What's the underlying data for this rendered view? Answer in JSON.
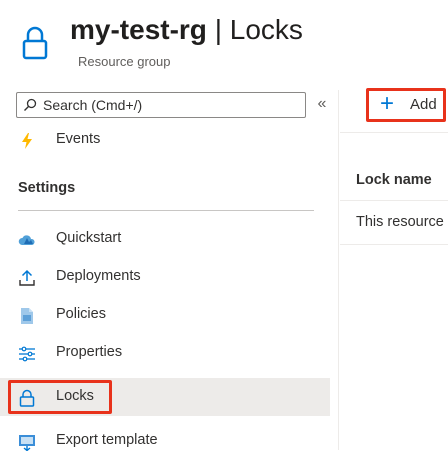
{
  "header": {
    "resource_name": "my-test-rg",
    "separator": " | ",
    "page_name": "Locks",
    "subtitle": "Resource group"
  },
  "search": {
    "placeholder": "Search (Cmd+/)"
  },
  "collapse_label": "«",
  "sidebar": {
    "events_label": "Events",
    "settings_title": "Settings",
    "items": [
      {
        "label": "Quickstart",
        "icon": "cloud-icon"
      },
      {
        "label": "Deployments",
        "icon": "upload-icon"
      },
      {
        "label": "Policies",
        "icon": "document-icon"
      },
      {
        "label": "Properties",
        "icon": "sliders-icon"
      },
      {
        "label": "Locks",
        "icon": "lock-icon",
        "selected": true
      },
      {
        "label": "Export template",
        "icon": "export-icon"
      }
    ]
  },
  "toolbar": {
    "add_label": "Add",
    "add_icon": "+"
  },
  "table": {
    "columns": [
      "Lock name"
    ],
    "rows": [
      [
        "This resource"
      ]
    ]
  },
  "colors": {
    "accent": "#0078d4",
    "highlight_box": "#e8321b",
    "selected_bg": "#edebe9",
    "events_icon": "#ffb900"
  }
}
